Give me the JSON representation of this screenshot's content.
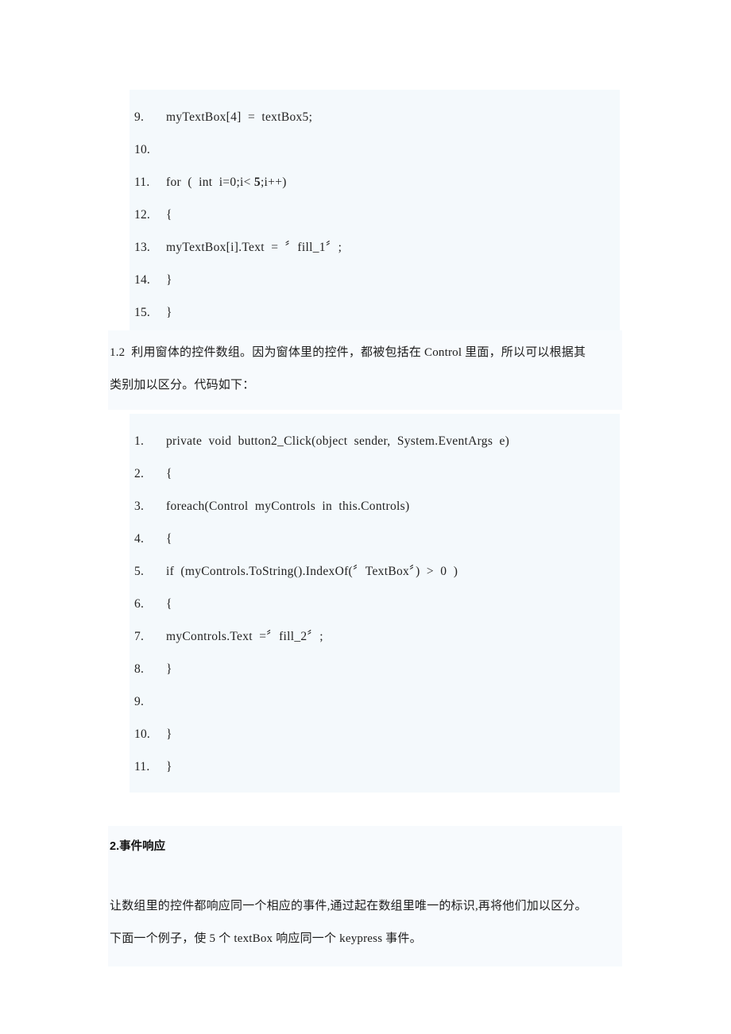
{
  "document": {
    "language": "zh-CN",
    "page_background": "#ffffff",
    "code_block_background": "#f4f9fc",
    "prose_block_background": "#f7fafd"
  },
  "code_block_1": {
    "name": "code-listing-control-array",
    "lines": [
      {
        "number": "9.",
        "code": "myTextBox[4]  =  textBox5;"
      },
      {
        "number": "10.",
        "code": ""
      },
      {
        "number": "11.",
        "code": "for  (  int  i=0;i< 5;i++)",
        "bold_token": "5"
      },
      {
        "number": "12.",
        "code": "{"
      },
      {
        "number": "13.",
        "code": "myTextBox[i].Text  =  〞fill_1〞;"
      },
      {
        "number": "14.",
        "code": "}"
      },
      {
        "number": "15.",
        "code": "}"
      }
    ]
  },
  "paragraph_1": {
    "name": "paragraph-1-2-control-array",
    "lines": [
      "1.2  利用窗体的控件数组。因为窗体里的控件，都被包括在 Control 里面，所以可以根据其",
      "类别加以区分。代码如下："
    ]
  },
  "code_block_2": {
    "name": "code-listing-foreach-controls",
    "lines": [
      {
        "number": "1.",
        "code": "private  void  button2_Click(object  sender,  System.EventArgs  e)"
      },
      {
        "number": "2.",
        "code": "{"
      },
      {
        "number": "3.",
        "code": "foreach(Control  myControls  in  this.Controls)"
      },
      {
        "number": "4.",
        "code": "{"
      },
      {
        "number": "5.",
        "code": "if  (myControls.ToString().IndexOf(〞TextBox〞)  >  0  )"
      },
      {
        "number": "6.",
        "code": "{"
      },
      {
        "number": "7.",
        "code": "myControls.Text  =〞fill_2〞;"
      },
      {
        "number": "8.",
        "code": "}"
      },
      {
        "number": "9.",
        "code": ""
      },
      {
        "number": "10.",
        "code": "}"
      },
      {
        "number": "11.",
        "code": "}"
      }
    ]
  },
  "section_2": {
    "name": "section-event-response",
    "heading": "2.事件响应",
    "lines": [
      "让数组里的控件都响应同一个相应的事件,通过起在数组里唯一的标识,再将他们加以区分。",
      "下面一个例子，使 5 个 textBox 响应同一个 keypress 事件。"
    ]
  }
}
